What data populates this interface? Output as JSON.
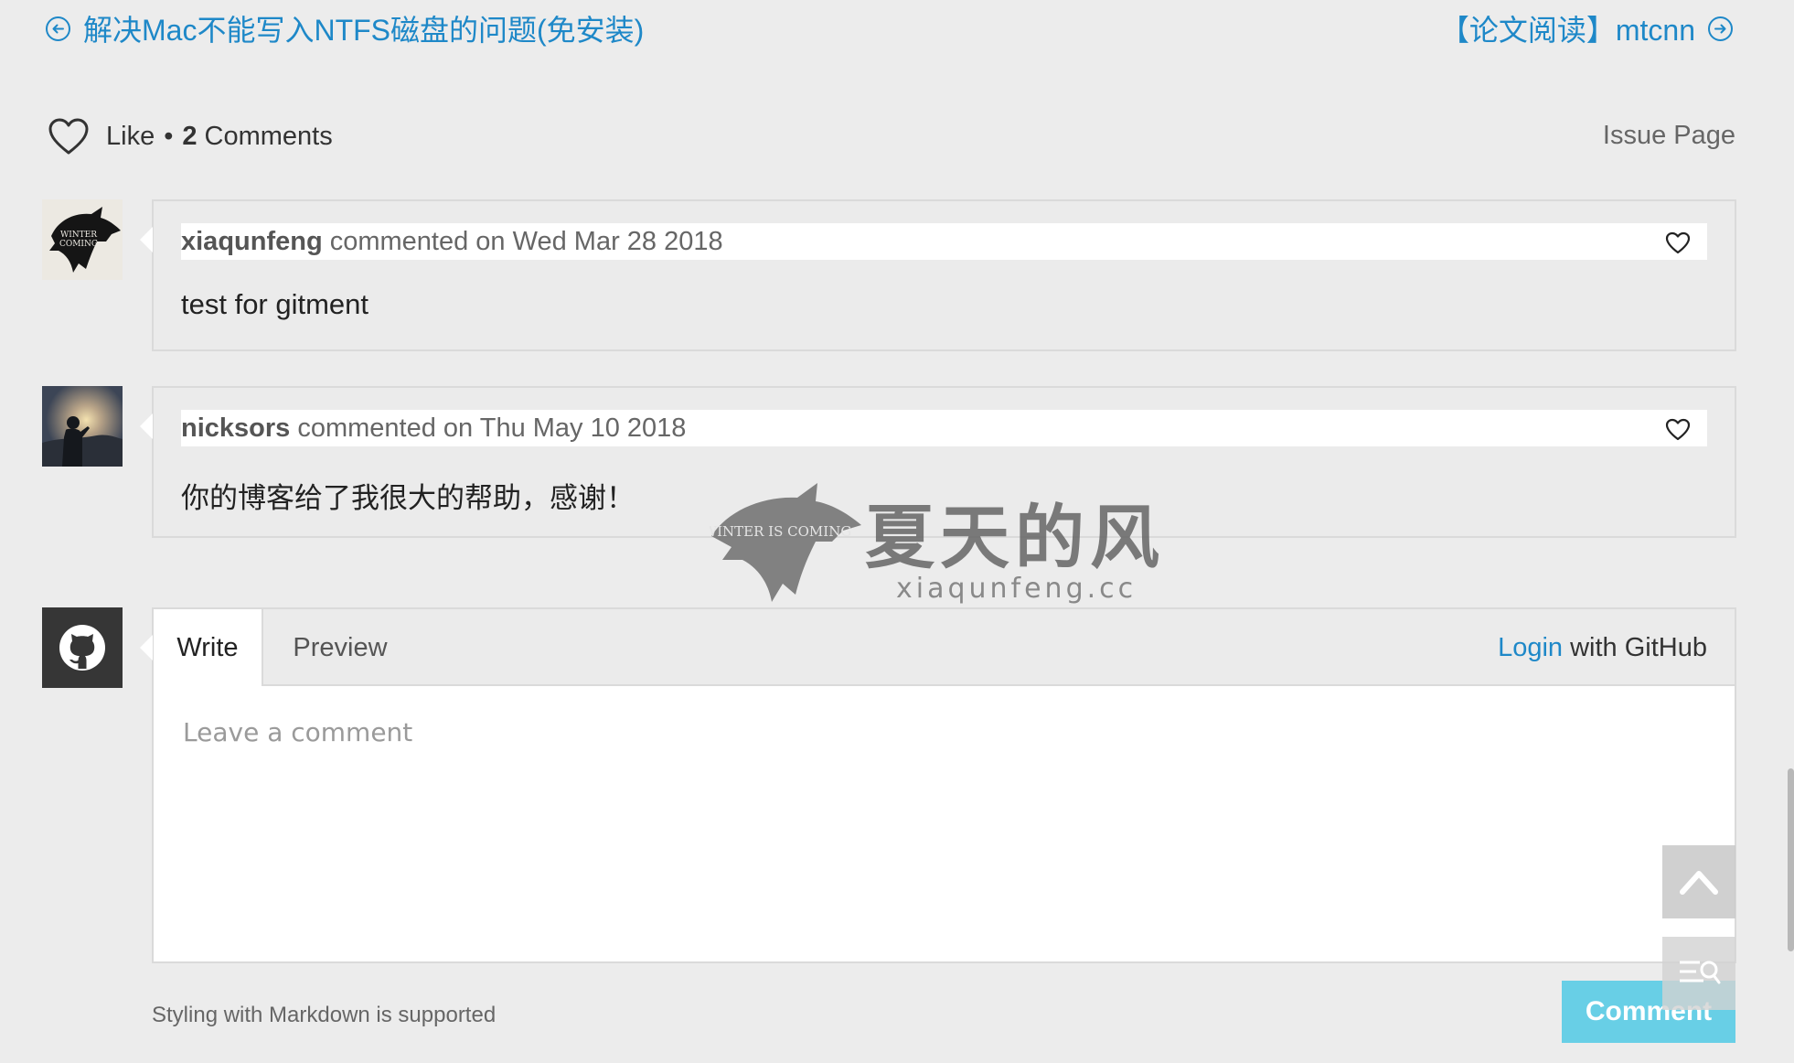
{
  "post_nav": {
    "prev_title": "解决Mac不能写入NTFS磁盘的问题(免安装)",
    "next_title": "【论文阅读】mtcnn"
  },
  "meta": {
    "like_label": "Like",
    "separator": "•",
    "comment_count": "2",
    "comments_label": "Comments",
    "issue_page_label": "Issue Page"
  },
  "comments": [
    {
      "author": "xiaqunfeng",
      "action": "commented on",
      "date": "Wed Mar 28 2018",
      "body": "test for gitment"
    },
    {
      "author": "nicksors",
      "action": "commented on",
      "date": "Thu May 10 2018",
      "body": "你的博客给了我很大的帮助，感谢！"
    }
  ],
  "editor": {
    "tab_write": "Write",
    "tab_preview": "Preview",
    "login_link": "Login",
    "login_suffix": "with GitHub",
    "placeholder": "Leave a comment",
    "markdown_note": "Styling with Markdown is supported",
    "submit_label": "Comment"
  },
  "watermark": {
    "logo_text": "WINTER IS COMING",
    "title": "夏天的风",
    "subtitle": "xiaqunfeng.cc"
  },
  "colors": {
    "link": "#1e88c8",
    "submit_button": "#68cfe6",
    "background": "#ececec"
  },
  "icons": {
    "prev": "arrow-left-circle-icon",
    "next": "arrow-right-circle-icon",
    "like": "heart-icon",
    "github": "github-icon",
    "back_to_top": "chevron-up-icon",
    "toc": "toc-search-icon"
  }
}
